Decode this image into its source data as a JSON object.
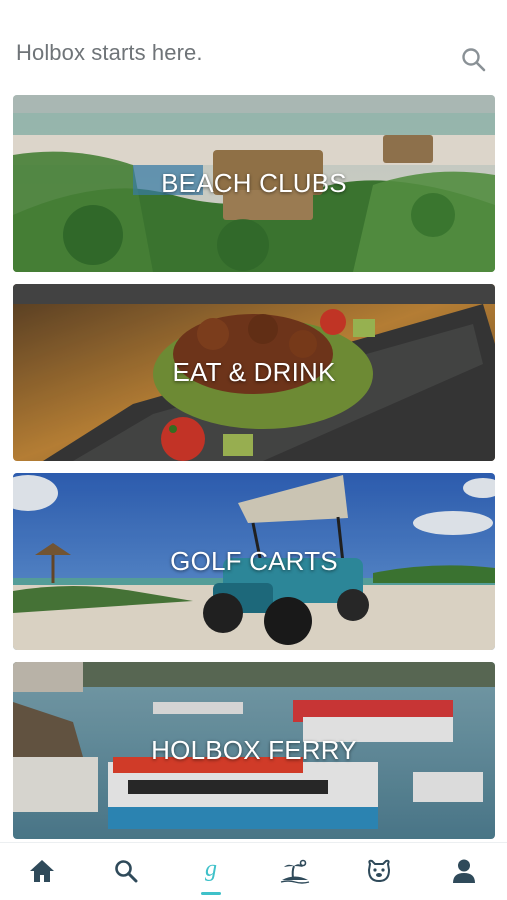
{
  "header": {
    "tagline": "Holbox starts here.",
    "search_icon": "search-icon"
  },
  "categories": [
    {
      "label": "BEACH CLUBS",
      "image": "aerial view of palapa beach club with palm trees"
    },
    {
      "label": "EAT & DRINK",
      "image": "plated octopus and guacamole dish on slate"
    },
    {
      "label": "GOLF CARTS",
      "image": "teal golf cart on sandy beach road"
    },
    {
      "label": "HOLBOX FERRY",
      "image": "ferry boats docked in harbor"
    }
  ],
  "tabbar": {
    "items": [
      {
        "name": "home",
        "icon": "home-icon"
      },
      {
        "name": "search",
        "icon": "search-icon"
      },
      {
        "name": "guide",
        "icon": "g-logo-icon",
        "glyph": "g",
        "active": true
      },
      {
        "name": "island",
        "icon": "island-icon"
      },
      {
        "name": "pets",
        "icon": "dog-icon"
      },
      {
        "name": "profile",
        "icon": "user-icon"
      }
    ]
  },
  "colors": {
    "icon": "#2f4a5a",
    "accent": "#3fc1c9",
    "tagline": "#6f7478"
  }
}
